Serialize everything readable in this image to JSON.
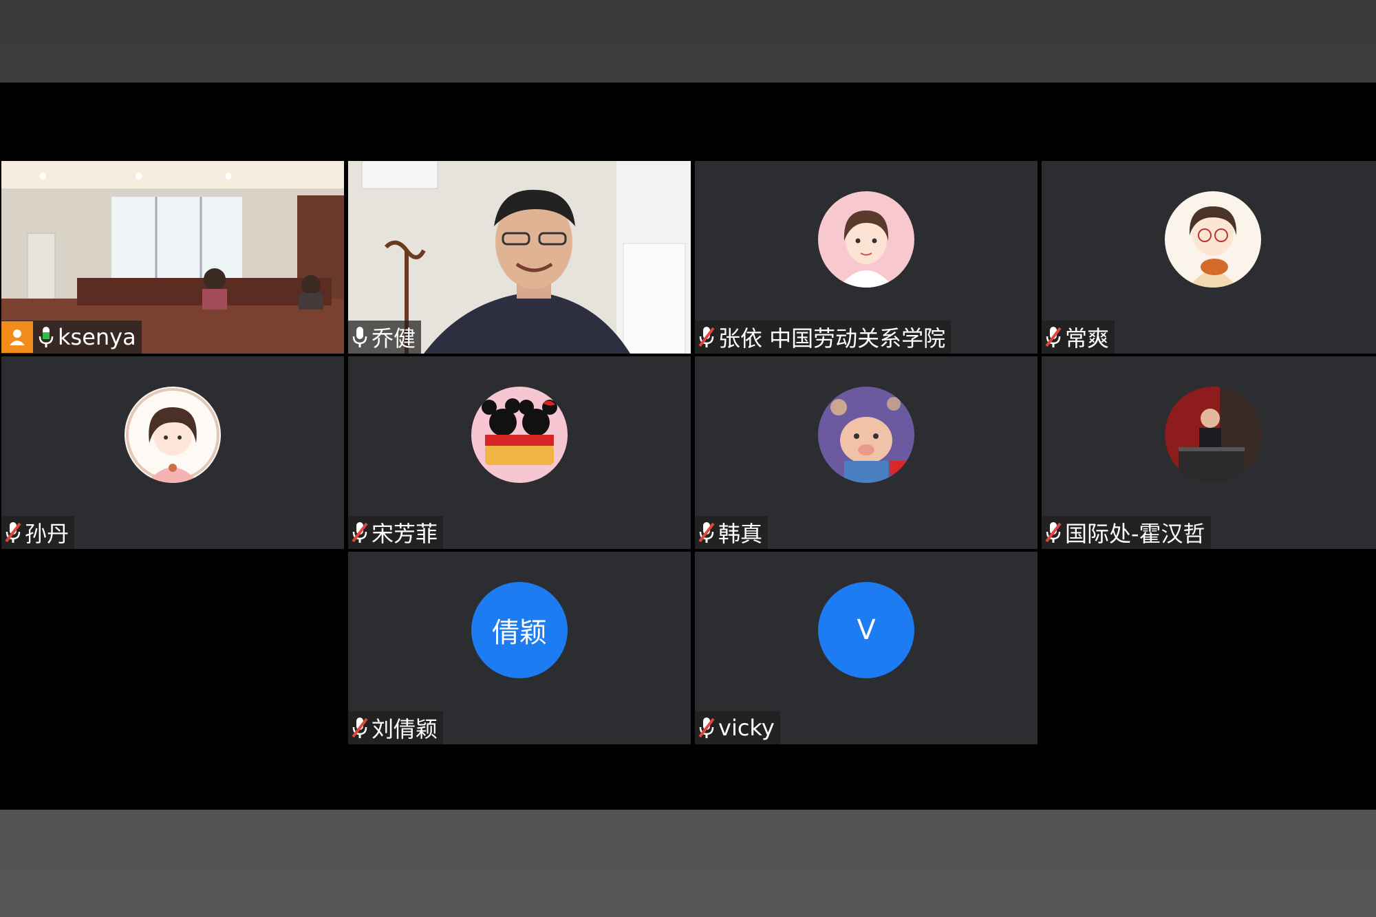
{
  "participants": [
    {
      "name": "ksenya",
      "type": "video",
      "mic": "on",
      "host": true,
      "speaking": true
    },
    {
      "name": "乔健",
      "type": "video",
      "mic": "on"
    },
    {
      "name": "张依 中国劳动关系学院",
      "type": "avatar",
      "mic": "muted"
    },
    {
      "name": "常爽",
      "type": "avatar",
      "mic": "muted"
    },
    {
      "name": "孙丹",
      "type": "avatar",
      "mic": "muted"
    },
    {
      "name": "宋芳菲",
      "type": "avatar",
      "mic": "muted"
    },
    {
      "name": "韩真",
      "type": "avatar",
      "mic": "muted"
    },
    {
      "name": "国际处-霍汉哲",
      "type": "avatar",
      "mic": "muted"
    },
    {
      "name": "刘倩颖",
      "type": "initials",
      "initials": "倩颖",
      "mic": "muted"
    },
    {
      "name": "vicky",
      "type": "initials",
      "initials": "V",
      "mic": "muted"
    }
  ],
  "colors": {
    "active_speaker_border": "#2fbd4e",
    "host_badge": "#f28c1b",
    "initials_avatar": "#1d7cf2",
    "tile_background": "#2b2d30",
    "mic_on": "#ffffff",
    "mic_muted": "#e0473c"
  }
}
